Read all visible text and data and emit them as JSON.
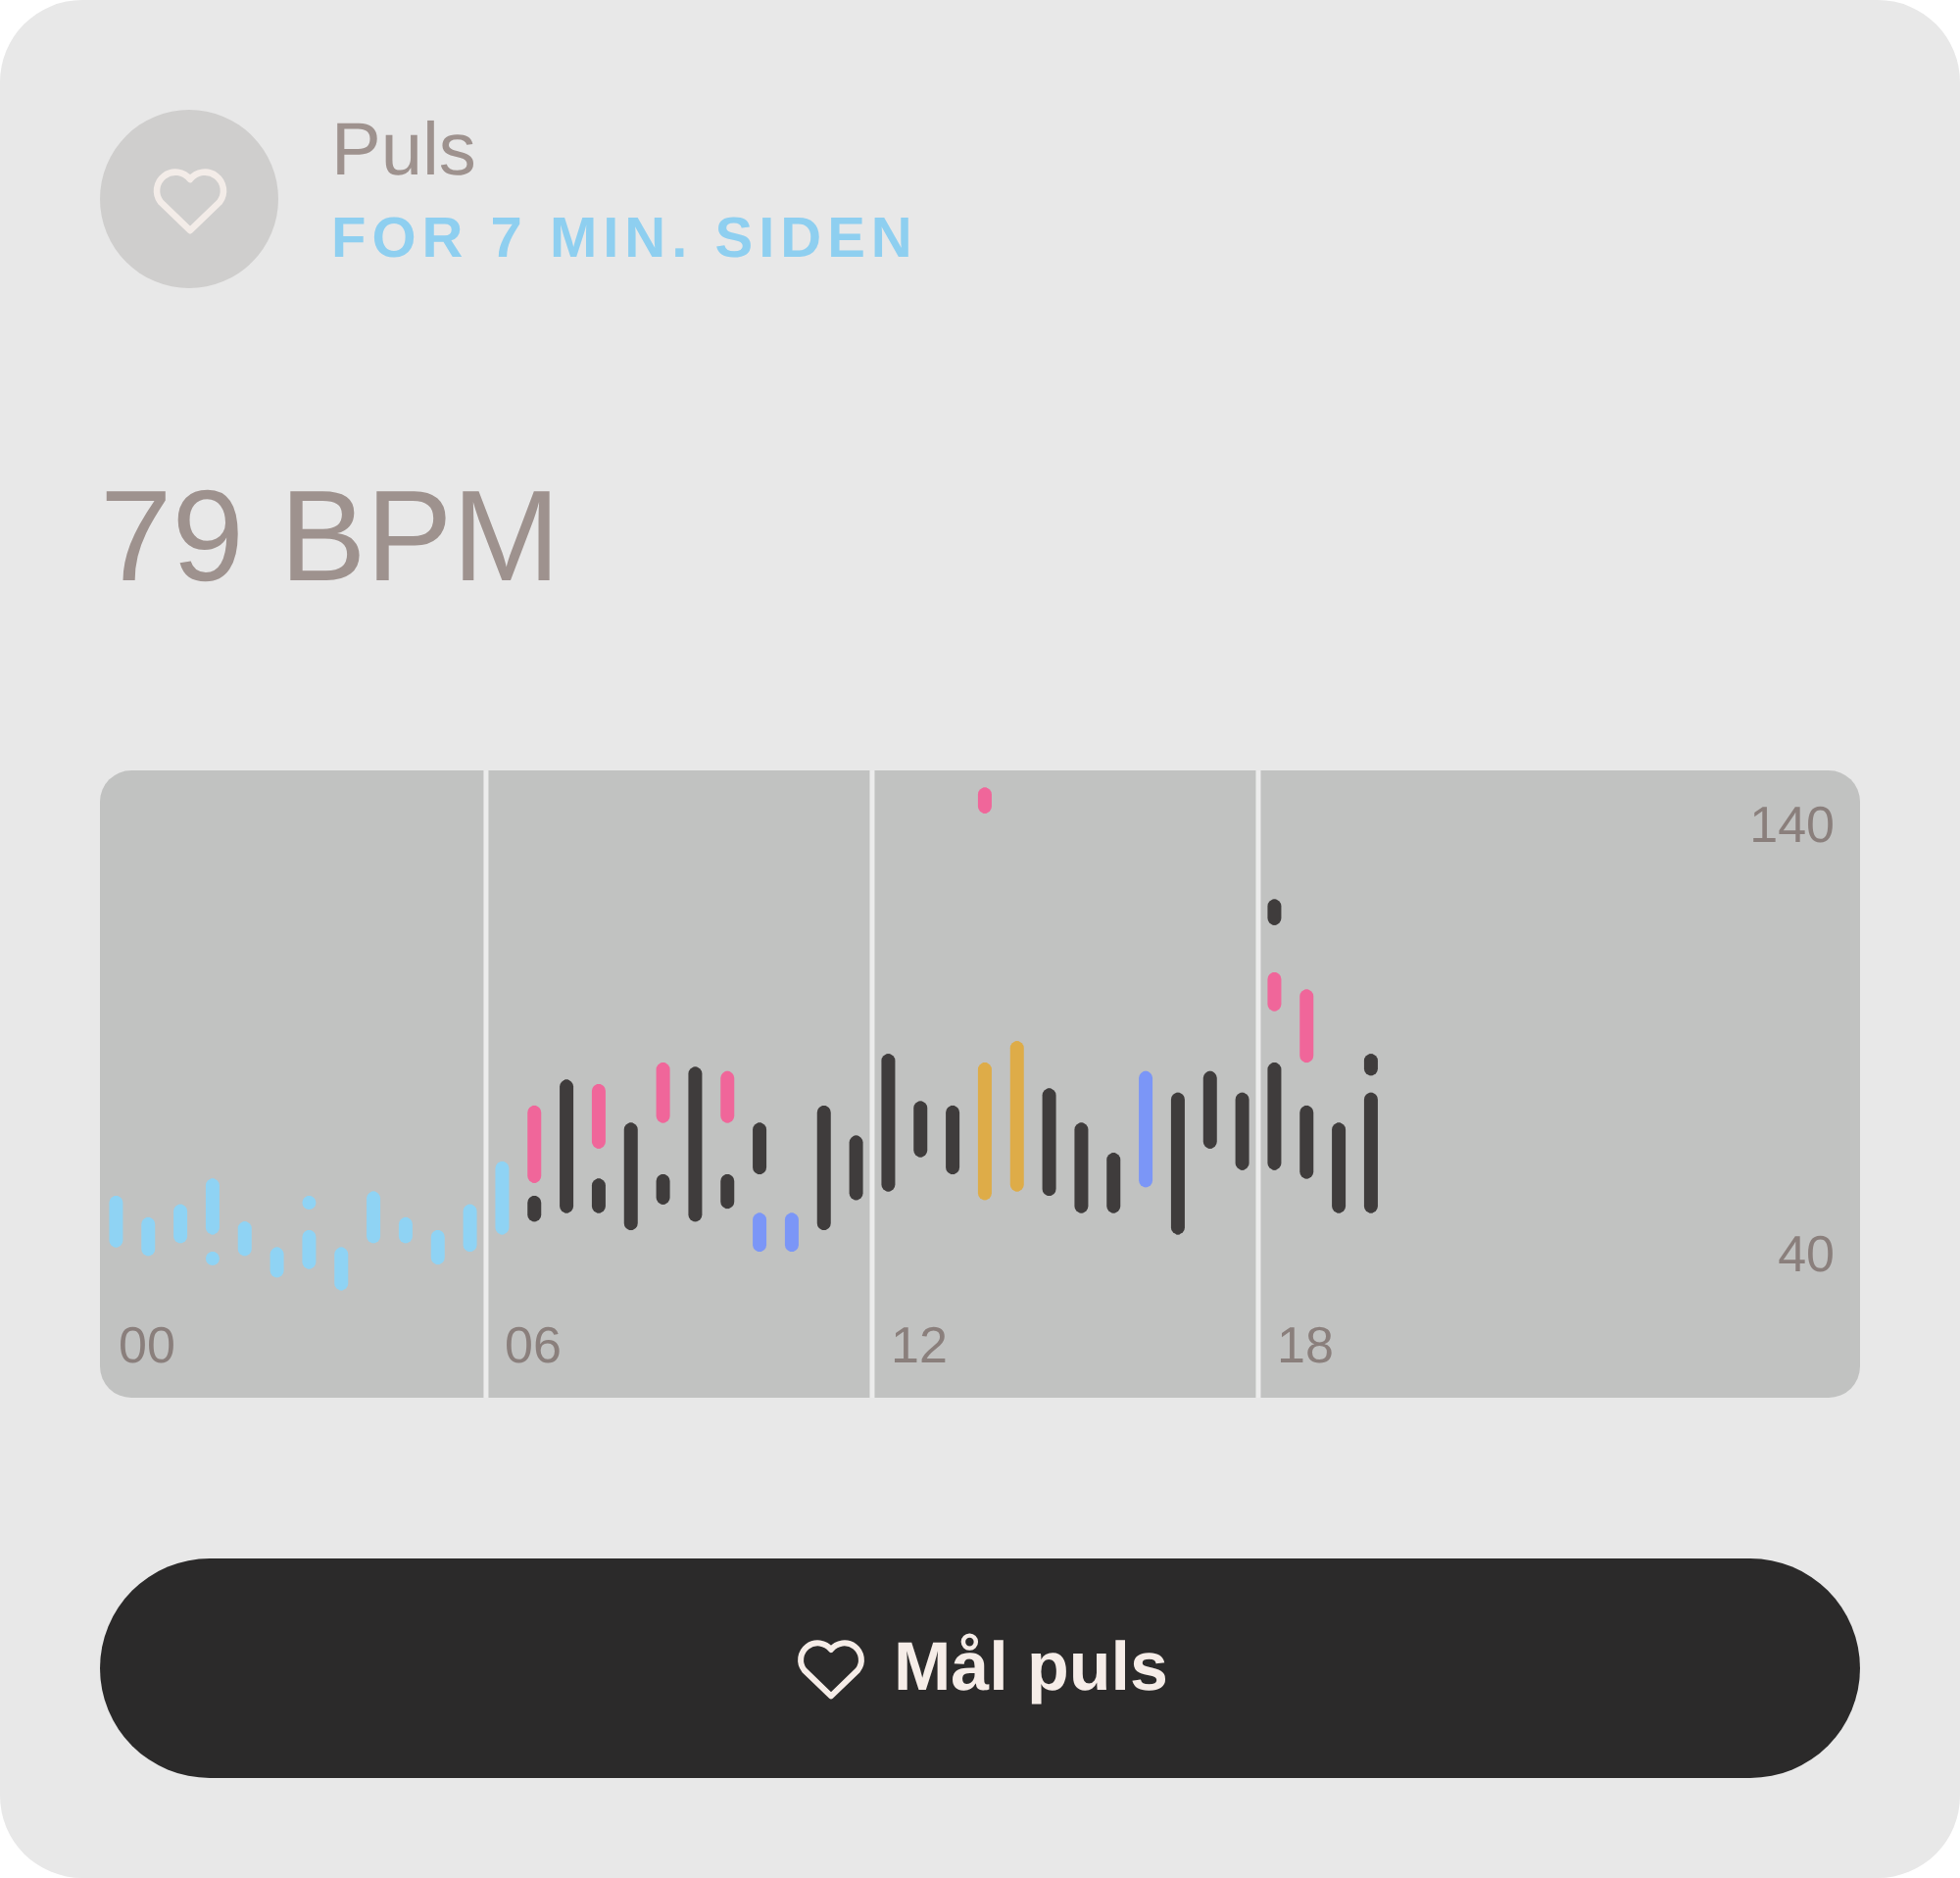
{
  "card": {
    "title": "Puls",
    "subtitle": "FOR 7 MIN. SIDEN",
    "reading": "79 BPM",
    "chart": {
      "chart_data": {
        "type": "candlestick",
        "orientation": "vertical",
        "xlim": [
          -0.73,
          26.62
        ],
        "ylim": [
          6,
          152
        ],
        "xticks": [
          {
            "value": 0,
            "label": "00"
          },
          {
            "value": 6,
            "label": "06"
          },
          {
            "value": 12,
            "label": "12"
          },
          {
            "value": 18,
            "label": "18"
          }
        ],
        "yticks": [
          40,
          140
        ],
        "x": [
          -0.48,
          0.02,
          0.52,
          1.02,
          1.52,
          2.02,
          2.52,
          3.02,
          3.52,
          4.02,
          4.52,
          5.02,
          5.52,
          6.02,
          6.52,
          7.02,
          7.52,
          8.02,
          8.52,
          9.02,
          9.52,
          10.02,
          10.52,
          11.02,
          11.52,
          12.02,
          12.52,
          13.02,
          13.52,
          14.02,
          14.52,
          15.02,
          15.52,
          16.02,
          16.52,
          17.02,
          17.52,
          18.02,
          18.52,
          19.02
        ],
        "series": [
          {
            "color": "#8fd3f4",
            "ohlc": [
              [
                41,
                53,
                41,
                53
              ],
              [
                39,
                48,
                39,
                48
              ],
              [
                42,
                51,
                42,
                51
              ],
              [
                44,
                57,
                44,
                57
              ],
              [
                39,
                47,
                39,
                47
              ],
              [
                34,
                41,
                34,
                41
              ],
              [
                36,
                45,
                36,
                45
              ],
              [
                31,
                41,
                31,
                41
              ],
              [
                42,
                54,
                42,
                54
              ],
              [
                42,
                48,
                42,
                48
              ],
              [
                37,
                45,
                37,
                45
              ],
              [
                40,
                51,
                40,
                51
              ],
              [
                44,
                61,
                44,
                61
              ],
              null,
              null,
              null,
              null,
              null,
              null,
              null,
              null,
              null,
              null,
              null,
              null,
              null,
              null,
              null,
              null,
              null,
              null,
              null,
              null,
              null,
              null,
              null,
              null,
              null,
              null,
              null
            ]
          },
          {
            "color": "#8fd3f4",
            "ohlc": [
              null,
              null,
              null,
              [
                37,
                40,
                37,
                40
              ],
              null,
              null,
              [
                50,
                53,
                50,
                53
              ],
              null,
              null,
              null,
              null,
              null,
              null,
              null,
              null,
              null,
              null,
              null,
              null,
              null,
              null,
              null,
              null,
              null,
              null,
              null,
              null,
              null,
              null,
              null,
              null,
              null,
              null,
              null,
              null,
              null,
              null,
              null,
              null,
              null
            ]
          },
          {
            "color": "#3f3c3c",
            "ohlc": [
              null,
              null,
              null,
              null,
              null,
              null,
              null,
              null,
              null,
              null,
              null,
              null,
              null,
              [
                47,
                53,
                47,
                53
              ],
              [
                49,
                80,
                49,
                80
              ],
              [
                49,
                57,
                49,
                57
              ],
              [
                45,
                70,
                45,
                70
              ],
              [
                51,
                58,
                51,
                58
              ],
              [
                47,
                83,
                47,
                83
              ],
              [
                50,
                58,
                50,
                58
              ],
              [
                58,
                70,
                58,
                70
              ],
              null,
              [
                45,
                74,
                45,
                74
              ],
              [
                52,
                67,
                52,
                67
              ],
              [
                54,
                86,
                54,
                86
              ],
              [
                62,
                75,
                62,
                75
              ],
              [
                58,
                74,
                58,
                74
              ],
              null,
              null,
              [
                53,
                78,
                53,
                78
              ],
              [
                49,
                70,
                49,
                70
              ],
              [
                49,
                63,
                49,
                63
              ],
              null,
              [
                44,
                77,
                44,
                77
              ],
              [
                64,
                82,
                64,
                82
              ],
              [
                59,
                77,
                59,
                77
              ],
              [
                59,
                84,
                59,
                84
              ],
              [
                57,
                74,
                57,
                74
              ],
              [
                49,
                70,
                49,
                70
              ],
              [
                49,
                77,
                49,
                77
              ]
            ]
          },
          {
            "color": "#3f3c3c",
            "ohlc": [
              null,
              null,
              null,
              null,
              null,
              null,
              null,
              null,
              null,
              null,
              null,
              null,
              null,
              null,
              null,
              null,
              null,
              null,
              null,
              null,
              null,
              null,
              null,
              null,
              null,
              null,
              null,
              null,
              null,
              null,
              null,
              null,
              null,
              null,
              null,
              null,
              [
                116,
                122,
                116,
                122
              ],
              null,
              null,
              [
                81,
                86,
                81,
                86
              ]
            ]
          },
          {
            "color": "#f0669a",
            "ohlc": [
              null,
              null,
              null,
              null,
              null,
              null,
              null,
              null,
              null,
              null,
              null,
              null,
              null,
              [
                56,
                74,
                56,
                74
              ],
              null,
              [
                64,
                79,
                64,
                79
              ],
              null,
              [
                70,
                84,
                70,
                84
              ],
              null,
              [
                70,
                82,
                70,
                82
              ],
              null,
              null,
              null,
              null,
              null,
              null,
              null,
              [
                142,
                148,
                142,
                148
              ],
              null,
              null,
              null,
              null,
              null,
              null,
              null,
              null,
              [
                96,
                105,
                96,
                105
              ],
              [
                84,
                101,
                84,
                101
              ],
              null,
              null
            ]
          },
          {
            "color": "#7b96f7",
            "ohlc": [
              null,
              null,
              null,
              null,
              null,
              null,
              null,
              null,
              null,
              null,
              null,
              null,
              null,
              null,
              null,
              null,
              null,
              null,
              null,
              null,
              [
                40,
                49,
                40,
                49
              ],
              [
                40,
                49,
                40,
                49
              ],
              null,
              null,
              null,
              null,
              null,
              null,
              null,
              null,
              null,
              null,
              [
                55,
                82,
                55,
                82
              ],
              null,
              null,
              null,
              null,
              null,
              null,
              null
            ]
          },
          {
            "color": "#deac48",
            "ohlc": [
              null,
              null,
              null,
              null,
              null,
              null,
              null,
              null,
              null,
              null,
              null,
              null,
              null,
              null,
              null,
              null,
              null,
              null,
              null,
              null,
              null,
              null,
              null,
              null,
              null,
              null,
              null,
              [
                52,
                84,
                52,
                84
              ],
              [
                54,
                89,
                54,
                89
              ],
              null,
              null,
              null,
              null,
              null,
              null,
              null,
              null,
              null,
              null,
              null
            ]
          }
        ]
      }
    },
    "button": {
      "label": "Mål puls"
    }
  }
}
